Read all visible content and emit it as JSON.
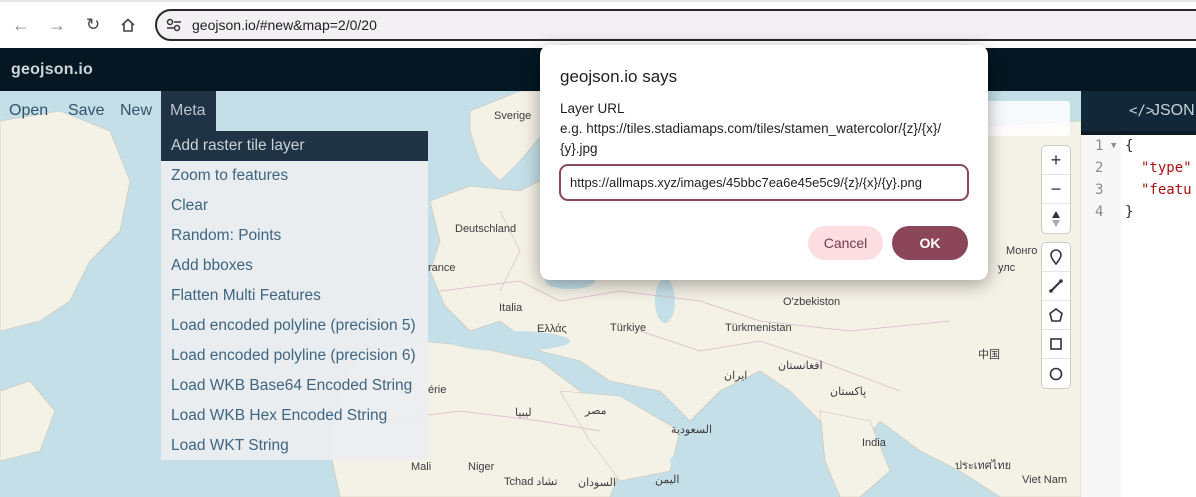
{
  "browser": {
    "back_icon": "arrow-left-icon",
    "forward_icon": "arrow-right-icon",
    "reload_icon": "reload-icon",
    "home_icon": "home-icon",
    "url": "geojson.io/#new&map=2/0/20"
  },
  "app": {
    "brand": "geojson.io"
  },
  "menu": {
    "items": [
      "Open",
      "Save",
      "New",
      "Meta"
    ],
    "active": "Meta"
  },
  "dropdown": {
    "items": [
      "Add raster tile layer",
      "Zoom to features",
      "Clear",
      "Random: Points",
      "Add bboxes",
      "Flatten Multi Features",
      "Load encoded polyline (precision 5)",
      "Load encoded polyline (precision 6)",
      "Load WKB Base64 Encoded String",
      "Load WKB Hex Encoded String",
      "Load WKT String"
    ],
    "hovered": "Add raster tile layer"
  },
  "map": {
    "labels": [
      "Sverige",
      "Deutschland",
      "rance",
      "Italia",
      "Ελλάς",
      "Türkiye",
      "O'zbekiston",
      "Türkmenistan",
      "Монго",
      "улс",
      "ایران",
      "افغانستان",
      "پاکستان",
      "中国",
      "érie",
      "ليبيا",
      "مصر",
      "السعودية",
      "India",
      "Mali",
      "Niger",
      "Tchad تشاد",
      "السودان",
      "اليمن",
      "ประเทศไทย",
      "Viet Nam"
    ]
  },
  "map_controls": {
    "zoom": [
      "zoom-in-icon",
      "zoom-out-icon",
      "compass-icon"
    ],
    "draw": [
      "marker-icon",
      "line-icon",
      "polygon-icon",
      "rectangle-icon",
      "circle-icon"
    ]
  },
  "json_panel": {
    "tab_icon": "</>",
    "tab_label": "JSON",
    "lines": [
      {
        "n": "1",
        "text": "{"
      },
      {
        "n": "2",
        "text": "\"type\""
      },
      {
        "n": "3",
        "text": "\"featu"
      },
      {
        "n": "4",
        "text": "}"
      }
    ]
  },
  "dialog": {
    "title": "geojson.io says",
    "message_line1": "Layer URL",
    "message_line2": "e.g. https://tiles.stadiamaps.com/tiles/stamen_watercolor/{z}/{x}/",
    "message_line3": "{y}.jpg",
    "input_value": "https://allmaps.xyz/images/45bbc7ea6e45e5c9/{z}/{x}/{y}.png",
    "cancel_label": "Cancel",
    "ok_label": "OK"
  }
}
